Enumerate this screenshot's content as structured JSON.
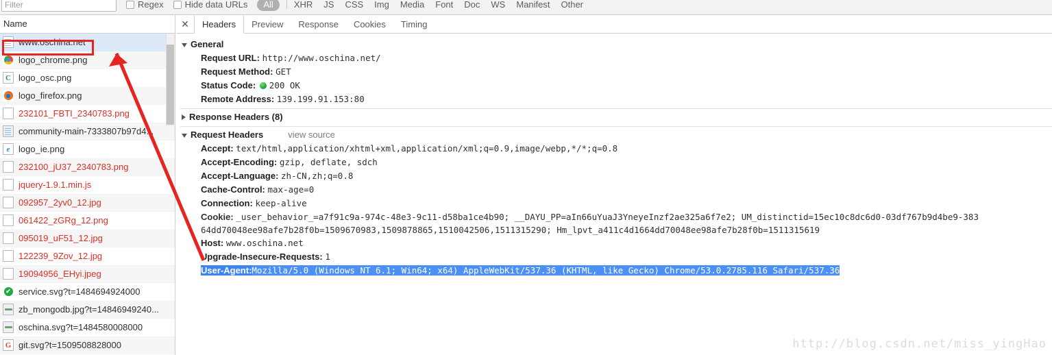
{
  "toolbar": {
    "filter_placeholder": "Filter",
    "regex_label": "Regex",
    "hide_data_urls_label": "Hide data URLs",
    "all_pill": "All",
    "filters": [
      "XHR",
      "JS",
      "CSS",
      "Img",
      "Media",
      "Font",
      "Doc",
      "WS",
      "Manifest",
      "Other"
    ]
  },
  "left_panel": {
    "column_header": "Name",
    "rows": [
      {
        "name": "www.oschina.net",
        "icon": "document-icon",
        "state": "selected",
        "error": false
      },
      {
        "name": "logo_chrome.png",
        "icon": "chrome-logo-icon",
        "state": "even",
        "error": false
      },
      {
        "name": "logo_osc.png",
        "icon": "osc-logo-icon",
        "state": "odd",
        "error": false
      },
      {
        "name": "logo_firefox.png",
        "icon": "firefox-logo-icon",
        "state": "even",
        "error": false
      },
      {
        "name": "232101_FBTI_2340783.png",
        "icon": "blank-file-icon",
        "state": "odd",
        "error": true
      },
      {
        "name": "community-main-7333807b97d4...",
        "icon": "stylesheet-icon",
        "state": "even",
        "error": false
      },
      {
        "name": "logo_ie.png",
        "icon": "ie-logo-icon",
        "state": "odd",
        "error": false
      },
      {
        "name": "232100_jU37_2340783.png",
        "icon": "blank-file-icon",
        "state": "even",
        "error": true
      },
      {
        "name": "jquery-1.9.1.min.js",
        "icon": "blank-file-icon",
        "state": "odd",
        "error": true
      },
      {
        "name": "092957_2yv0_12.jpg",
        "icon": "blank-file-icon",
        "state": "even",
        "error": true
      },
      {
        "name": "061422_zGRg_12.png",
        "icon": "blank-file-icon",
        "state": "odd",
        "error": true
      },
      {
        "name": "095019_uF51_12.jpg",
        "icon": "blank-file-icon",
        "state": "even",
        "error": true
      },
      {
        "name": "122239_9Zov_12.jpg",
        "icon": "blank-file-icon",
        "state": "odd",
        "error": true
      },
      {
        "name": "19094956_EHyi.jpeg",
        "icon": "blank-file-icon",
        "state": "even",
        "error": true
      },
      {
        "name": "service.svg?t=1484694924000",
        "icon": "svg-check-icon",
        "state": "odd",
        "error": false
      },
      {
        "name": "zb_mongodb.jpg?t=14846949240...",
        "icon": "image-thumb-icon",
        "state": "even",
        "error": false
      },
      {
        "name": "oschina.svg?t=1484580008000",
        "icon": "image-thumb-icon",
        "state": "odd",
        "error": false
      },
      {
        "name": "git.svg?t=1509508828000",
        "icon": "git-logo-icon",
        "state": "even",
        "error": false
      }
    ]
  },
  "right_panel": {
    "close_glyph": "✕",
    "tabs": [
      {
        "label": "Headers",
        "active": true
      },
      {
        "label": "Preview",
        "active": false
      },
      {
        "label": "Response",
        "active": false
      },
      {
        "label": "Cookies",
        "active": false
      },
      {
        "label": "Timing",
        "active": false
      }
    ],
    "general": {
      "title": "General",
      "expanded": true,
      "rows": [
        {
          "key": "Request URL:",
          "value": "http://www.oschina.net/"
        },
        {
          "key": "Request Method:",
          "value": "GET"
        },
        {
          "key": "Status Code:",
          "value": "200 OK",
          "has_status_dot": true
        },
        {
          "key": "Remote Address:",
          "value": "139.199.91.153:80"
        }
      ]
    },
    "response_headers": {
      "title": "Response Headers (8)",
      "expanded": false
    },
    "request_headers": {
      "title": "Request Headers",
      "view_source": "view source",
      "expanded": true,
      "rows": [
        {
          "key": "Accept:",
          "value": "text/html,application/xhtml+xml,application/xml;q=0.9,image/webp,*/*;q=0.8"
        },
        {
          "key": "Accept-Encoding:",
          "value": "gzip, deflate, sdch"
        },
        {
          "key": "Accept-Language:",
          "value": "zh-CN,zh;q=0.8"
        },
        {
          "key": "Cache-Control:",
          "value": "max-age=0"
        },
        {
          "key": "Connection:",
          "value": "keep-alive"
        }
      ],
      "cookie": {
        "key": "Cookie:",
        "line1": "_user_behavior_=a7f91c9a-974c-48e3-9c11-d58ba1ce4b90; __DAYU_PP=aIn66uYuaJ3YneyeInzf2ae325a6f7e2; UM_distinctid=15ec10c8dc6d0-03df767b9d4be9-383",
        "line2": "64dd70048ee98afe7b28f0b=1509670983,1509878865,1510042506,1511315290; Hm_lpvt_a411c4d1664dd70048ee98afe7b28f0b=1511315619"
      },
      "rows_after": [
        {
          "key": "Host:",
          "value": "www.oschina.net"
        },
        {
          "key": "Upgrade-Insecure-Requests:",
          "value": "1"
        }
      ],
      "user_agent": {
        "key": "User-Agent:",
        "value": "Mozilla/5.0 (Windows NT 6.1; Win64; x64) AppleWebKit/537.36 (KHTML, like Gecko) Chrome/53.0.2785.116 Safari/537.36",
        "highlight_key_color": "#3b84f2",
        "highlight_value_color": "#4a90f7"
      }
    }
  },
  "annotation": {
    "arrow_color": "#e52521",
    "highlight_box_color": "#e52521"
  },
  "watermark": {
    "text": "http://blog.csdn.net/miss_yingHao"
  }
}
